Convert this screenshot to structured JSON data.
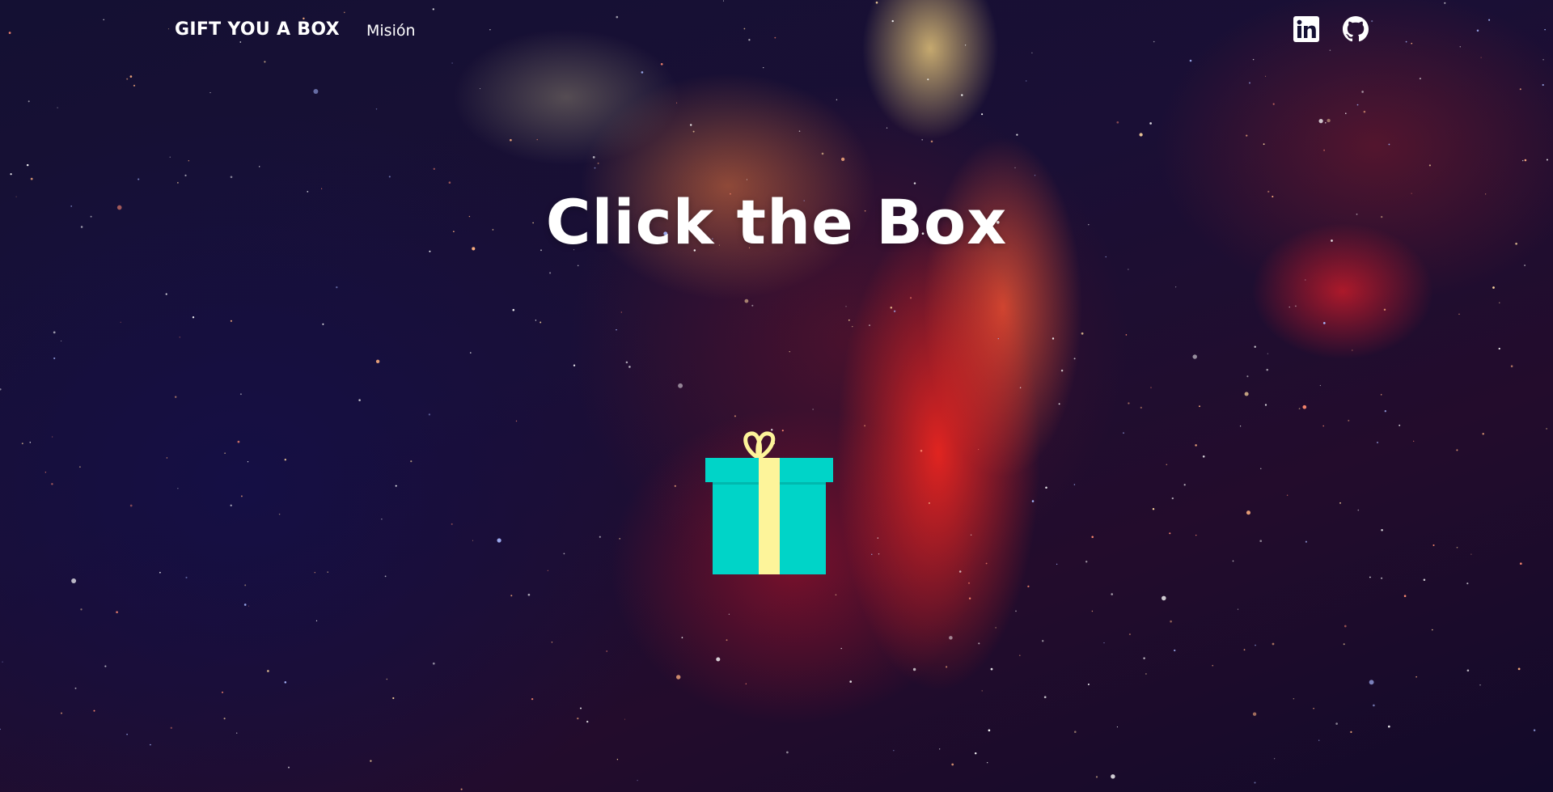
{
  "navbar": {
    "brand": "GIFT YOU A BOX",
    "links": [
      {
        "label": "Misión"
      }
    ],
    "social": [
      {
        "icon": "linkedin-icon"
      },
      {
        "icon": "github-icon"
      }
    ]
  },
  "hero": {
    "title": "Click the Box"
  },
  "gift": {
    "icon": "gift-box-icon",
    "box_color": "#00d4c8",
    "ribbon_color": "#fdf49a"
  }
}
